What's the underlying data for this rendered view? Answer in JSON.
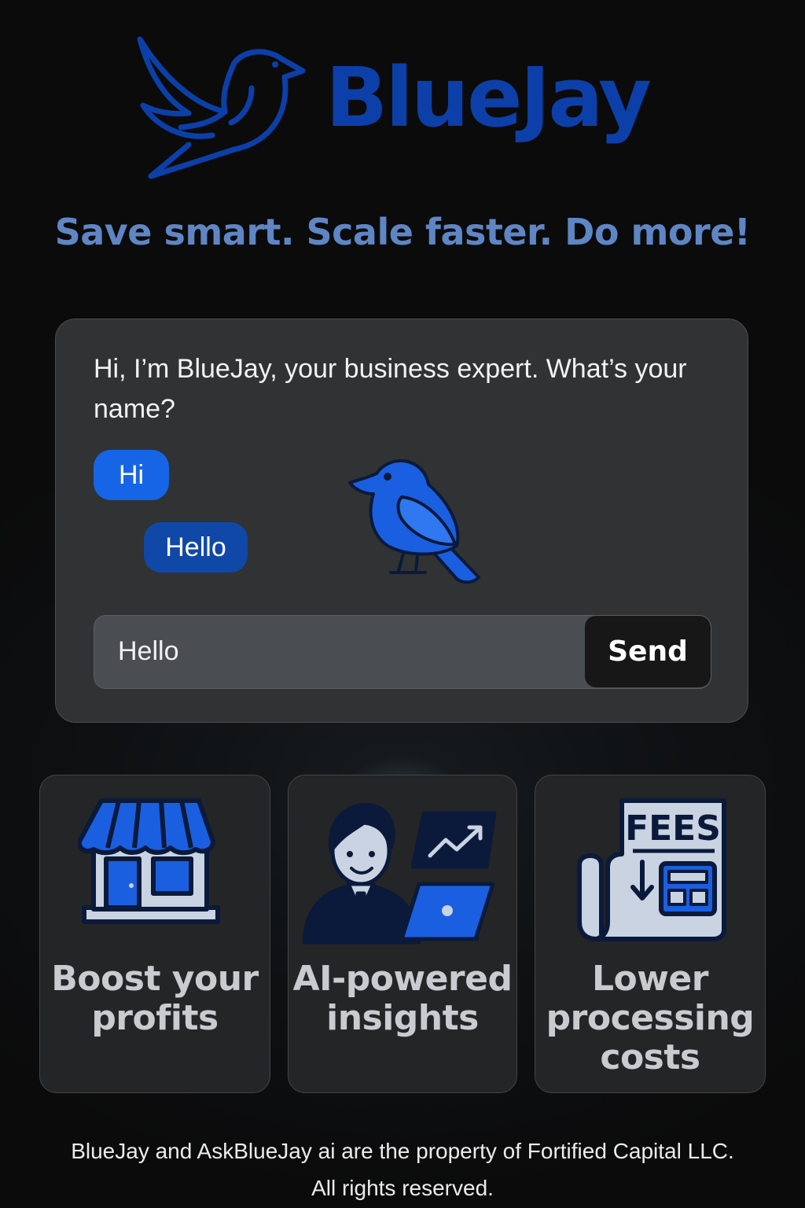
{
  "brand": {
    "name": "BlueJay",
    "tagline": "Save smart. Scale faster. Do more!",
    "colors": {
      "brand": "#0c3fa8",
      "tagline": "#5f86c4",
      "bubble_primary": "#1565e6",
      "bubble_secondary": "#1048a8"
    },
    "logo_icon": "bird-logo-icon"
  },
  "chat": {
    "greeting": "Hi, I’m BlueJay, your business expert. What’s your name?",
    "bubbles": [
      "Hi",
      "Hello"
    ],
    "mascot_icon": "bluejay-mascot-icon",
    "input_value": "Hello",
    "input_placeholder": "",
    "send_label": "Send"
  },
  "features": [
    {
      "label": "Boost your profits",
      "icon": "storefront-icon"
    },
    {
      "label": "AI-powered insights",
      "icon": "analyst-laptop-icon"
    },
    {
      "label": "Lower processing costs",
      "icon": "fees-document-icon",
      "icon_text": "FEES"
    }
  ],
  "footer": {
    "line1": "BlueJay and AskBlueJay ai are the property of Fortified Capital LLC.",
    "line2": "All rights reserved."
  }
}
